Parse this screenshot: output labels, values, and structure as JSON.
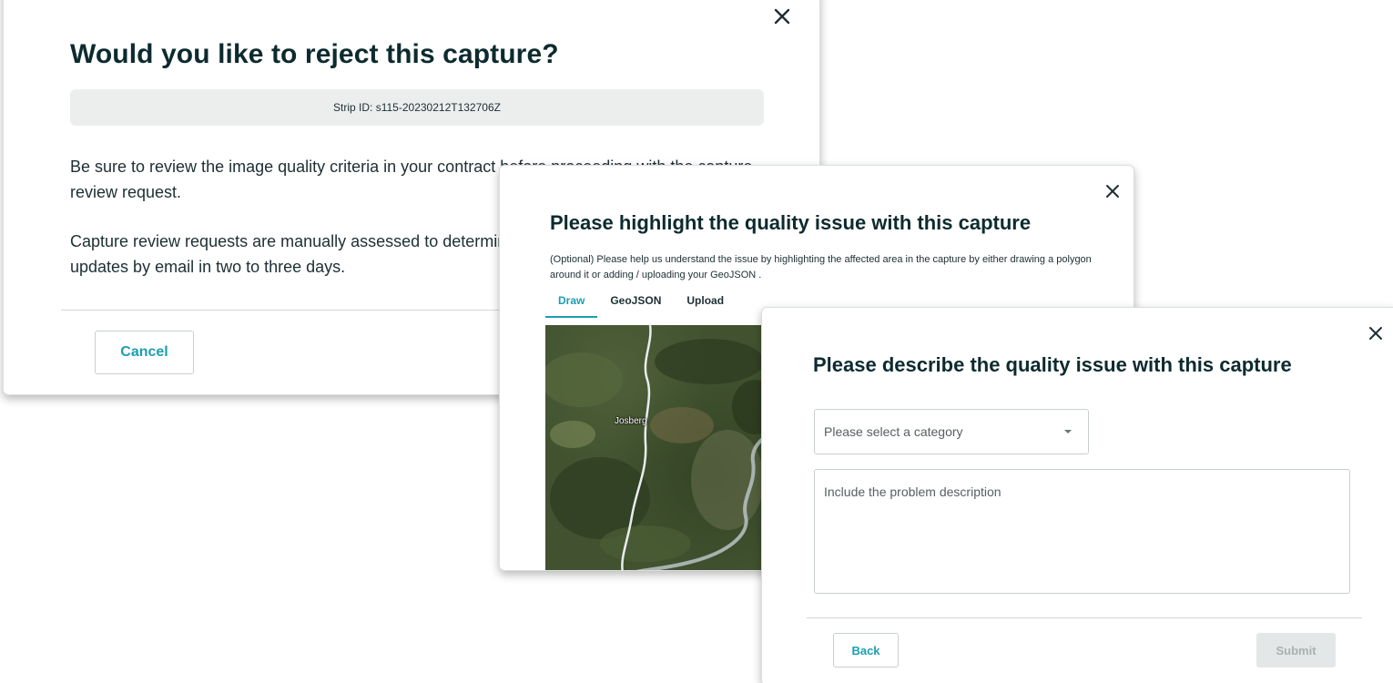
{
  "reject_dialog": {
    "title": "Would you like to reject this capture?",
    "strip_id": "Strip ID: s115-20230212T132706Z",
    "paragraph1": "Be sure to review the image quality criteria in your contract before proceeding with the capture review request.",
    "paragraph2": "Capture review requests are manually assessed to determine eligibility. You will be notified of updates by email in two to three days.",
    "cancel_label": "Cancel"
  },
  "highlight_dialog": {
    "title": "Please highlight the quality issue with this capture",
    "description": "(Optional) Please help us understand the issue by highlighting the affected area in the capture by either drawing a polygon around it or adding / uploading your GeoJSON .",
    "tabs": [
      {
        "label": "Draw",
        "active": true
      },
      {
        "label": "GeoJSON",
        "active": false
      },
      {
        "label": "Upload",
        "active": false
      }
    ],
    "map_label": "Josberg"
  },
  "describe_dialog": {
    "title": "Please describe the quality issue with this capture",
    "category_placeholder": "Please select a category",
    "description_placeholder": "Include the problem description",
    "back_label": "Back",
    "submit_label": "Submit"
  },
  "colors": {
    "accent": "#1a9fb1",
    "heading": "#0d2b2f",
    "disabled_bg": "#e4e7e7"
  }
}
